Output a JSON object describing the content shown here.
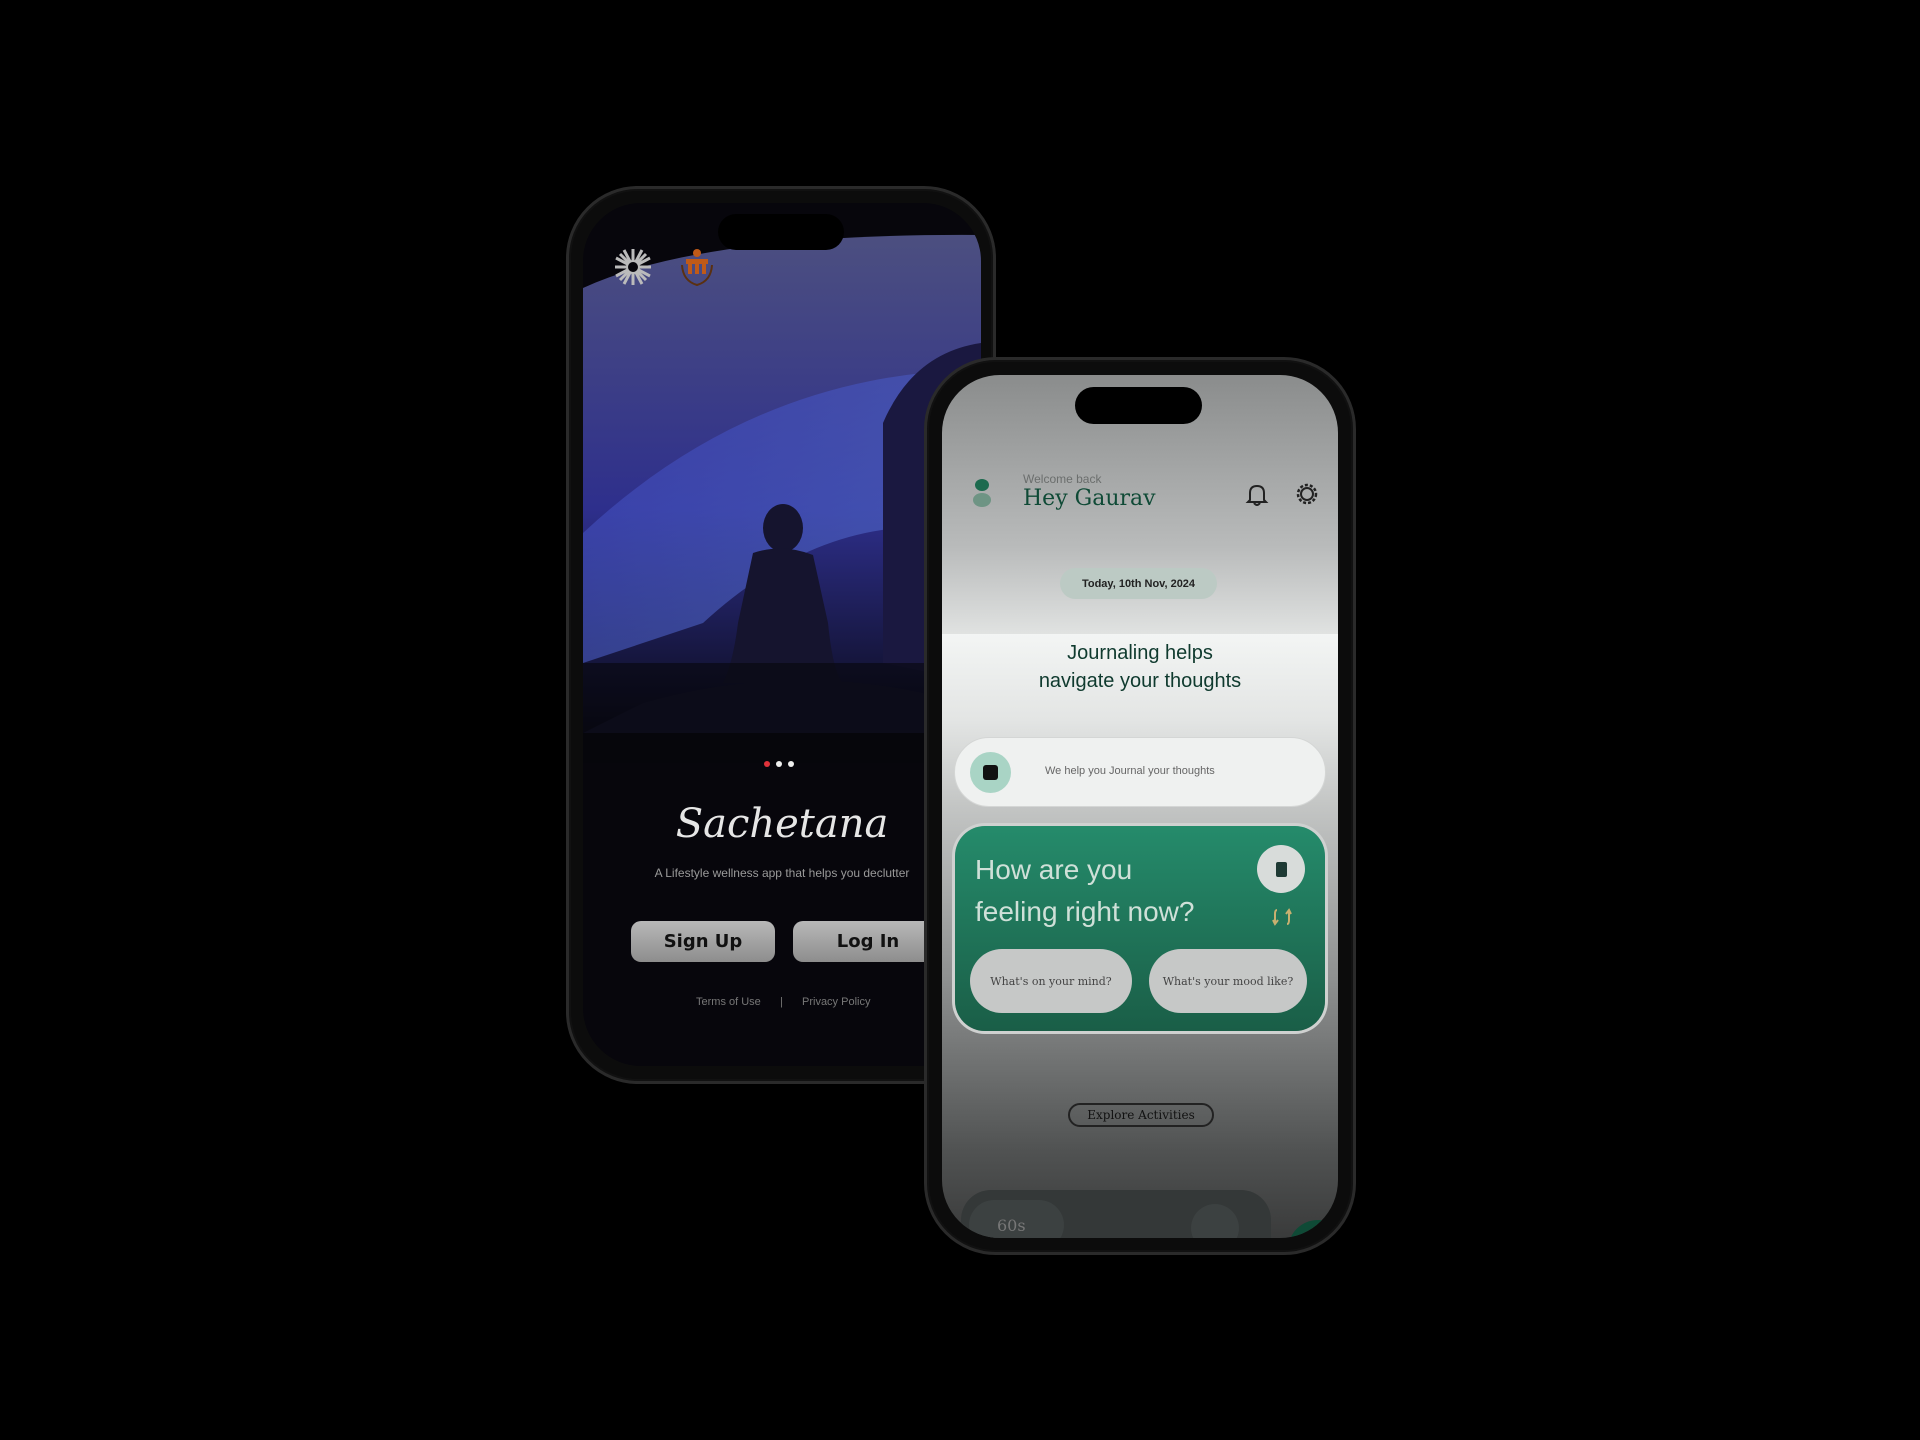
{
  "onboarding": {
    "app_name": "Sachetana",
    "tagline": "A Lifestyle wellness app that helps you declutter",
    "sign_up_label": "Sign Up",
    "log_in_label": "Log In",
    "terms_label": "Terms of Use",
    "divider": "|",
    "privacy_label": "Privacy Policy",
    "carousel": {
      "count": 3,
      "active": 0,
      "active_color": "#e0323a"
    }
  },
  "home": {
    "welcome": "Welcome back",
    "greeting": "Hey Gaurav",
    "date": "Today, 10th Nov, 2024",
    "headline_1": "Journaling helps",
    "headline_2": "navigate your thoughts",
    "journal_prompt": "We help you Journal your thoughts",
    "card": {
      "title_1": "How are you",
      "title_2": "feeling right now?",
      "option_1": "What's on your mind?",
      "option_2": "What's your mood like?"
    },
    "explore_label": "Explore Activities",
    "timer_label": "60s",
    "accent": "#238a68"
  }
}
